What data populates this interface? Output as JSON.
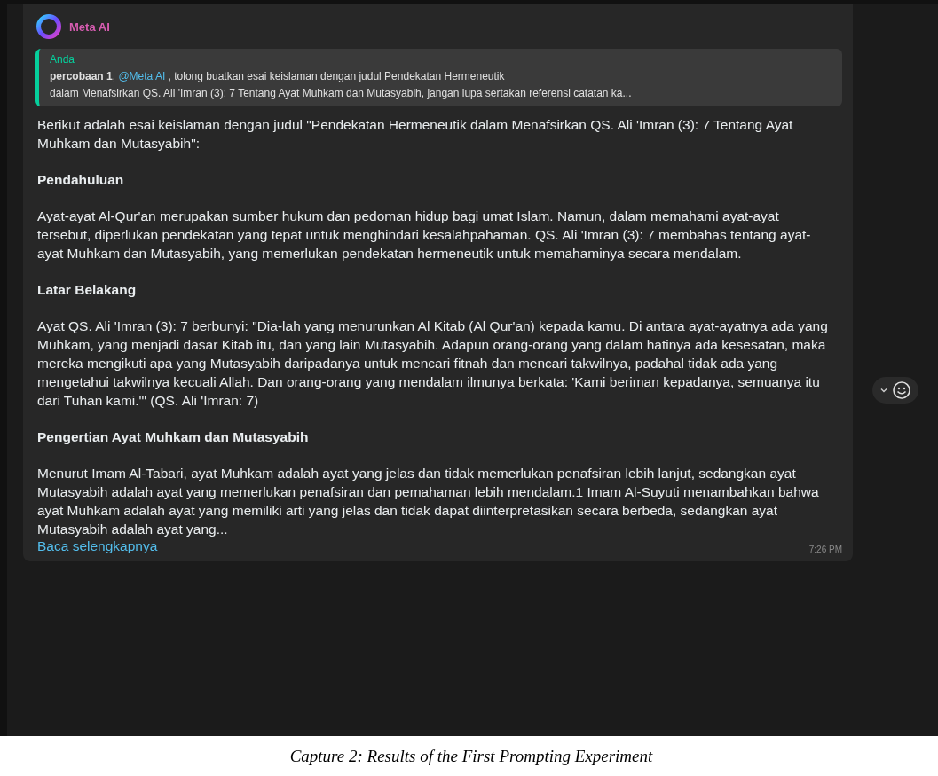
{
  "sender": {
    "name": "Meta AI"
  },
  "quote": {
    "author": "Anda",
    "prefix": "**percobaan 1**,",
    "mention": "@Meta AI",
    "line1_rest": " , tolong buatkan esai keislaman dengan judul Pendekatan Hermeneutik",
    "line2": "dalam Menafsirkan QS. Ali 'Imran (3): 7 Tentang Ayat Muhkam dan Mutasyabih, jangan lupa sertakan referensi catatan ka..."
  },
  "blocks": [
    {
      "kind": "text",
      "text": "Berikut adalah esai keislaman dengan judul \"Pendekatan Hermeneutik dalam Menafsirkan QS. Ali 'Imran (3): 7 Tentang Ayat Muhkam dan Mutasyabih\":"
    },
    {
      "kind": "heading",
      "text": "Pendahuluan"
    },
    {
      "kind": "text",
      "text": "Ayat-ayat Al-Qur'an merupakan sumber hukum dan pedoman hidup bagi umat Islam. Namun, dalam memahami ayat-ayat tersebut, diperlukan pendekatan yang tepat untuk menghindari kesalahpahaman. QS. Ali 'Imran (3): 7 membahas tentang ayat-ayat Muhkam dan Mutasyabih, yang memerlukan pendekatan hermeneutik untuk memahaminya secara mendalam."
    },
    {
      "kind": "heading",
      "text": "Latar Belakang"
    },
    {
      "kind": "text",
      "text": "Ayat QS. Ali 'Imran (3): 7 berbunyi: \"Dia-lah yang menurunkan Al Kitab (Al Qur'an) kepada kamu. Di antara ayat-ayatnya ada yang Muhkam, yang menjadi dasar Kitab itu, dan yang lain Mutasyabih. Adapun orang-orang yang dalam hatinya ada kesesatan, maka mereka mengikuti apa yang Mutasyabih daripadanya untuk mencari fitnah dan mencari takwilnya, padahal tidak ada yang mengetahui takwilnya kecuali Allah. Dan orang-orang yang mendalam ilmunya berkata: 'Kami beriman kepadanya, semuanya itu dari Tuhan kami.'\" (QS. Ali 'Imran: 7)"
    },
    {
      "kind": "heading",
      "text": "Pengertian Ayat Muhkam dan Mutasyabih"
    },
    {
      "kind": "text",
      "text": "Menurut Imam Al-Tabari, ayat Muhkam adalah ayat yang jelas dan tidak memerlukan penafsiran lebih lanjut, sedangkan ayat Mutasyabih adalah ayat yang memerlukan penafsiran dan pemahaman lebih mendalam.1 Imam Al-Suyuti menambahkan bahwa ayat Muhkam adalah ayat yang memiliki arti yang jelas dan tidak dapat diinterpretasikan secara berbeda, sedangkan ayat Mutasyabih adalah ayat yang..."
    }
  ],
  "read_more": "Baca selengkapnya",
  "time": "7:26 PM",
  "caption": "Capture 2: Results of the First Prompting Experiment"
}
